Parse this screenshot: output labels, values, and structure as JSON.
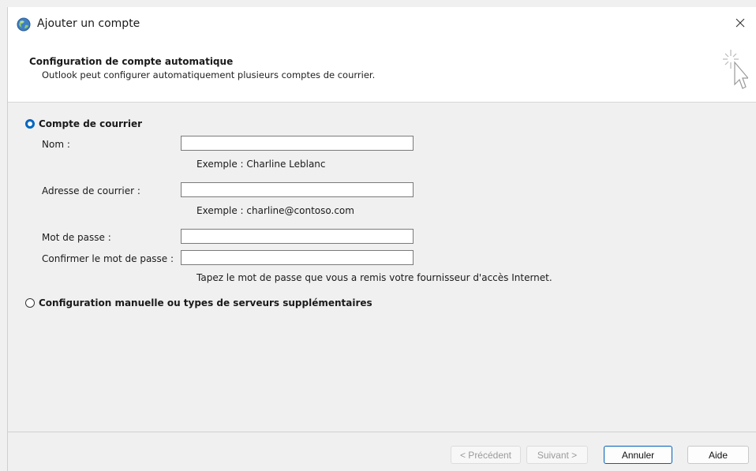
{
  "window": {
    "title": "Ajouter un compte",
    "close_glyph": "✕"
  },
  "header": {
    "title": "Configuration de compte automatique",
    "subtitle": "Outlook peut configurer automatiquement plusieurs comptes de courrier.",
    "icon": "wizard-cursor-icon"
  },
  "options": {
    "email_account": {
      "label": "Compte de courrier",
      "selected": true
    },
    "manual_setup": {
      "label": "Configuration manuelle ou types de serveurs supplémentaires",
      "selected": false
    }
  },
  "form": {
    "name": {
      "label": "Nom :",
      "value": "",
      "hint": "Exemple : Charline Leblanc"
    },
    "email": {
      "label": "Adresse de courrier :",
      "value": "",
      "hint": "Exemple : charline@contoso.com"
    },
    "password": {
      "label": "Mot de passe :",
      "value": ""
    },
    "confirm_password": {
      "label": "Confirmer le mot de passe :",
      "value": ""
    },
    "password_hint": "Tapez le mot de passe que vous a remis votre fournisseur d'accès Internet."
  },
  "buttons": {
    "previous": "< Précédent",
    "next": "Suivant >",
    "cancel": "Annuler",
    "help": "Aide"
  },
  "colors": {
    "accent": "#0067c0",
    "primary_border": "#005fb8"
  }
}
